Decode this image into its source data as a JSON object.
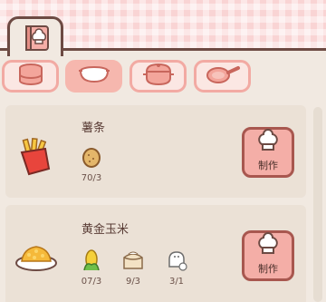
{
  "categories": [
    {
      "icon": "storage-barrel-icon",
      "active": false
    },
    {
      "icon": "bowl-icon",
      "active": true
    },
    {
      "icon": "pot-icon",
      "active": false
    },
    {
      "icon": "frying-pan-icon",
      "active": false
    }
  ],
  "recipes": [
    {
      "name": "薯条",
      "dish_icon": "french-fries-icon",
      "ingredients": [
        {
          "icon": "potato-icon",
          "count": "70/3"
        }
      ],
      "button_label": "制作"
    },
    {
      "name": "黄金玉米",
      "dish_icon": "golden-corn-dish-icon",
      "ingredients": [
        {
          "icon": "corn-icon",
          "count": "07/3"
        },
        {
          "icon": "flour-sack-icon",
          "count": "9/3"
        },
        {
          "icon": "salt-icon",
          "count": "3/1"
        }
      ],
      "button_label": "制作"
    }
  ]
}
